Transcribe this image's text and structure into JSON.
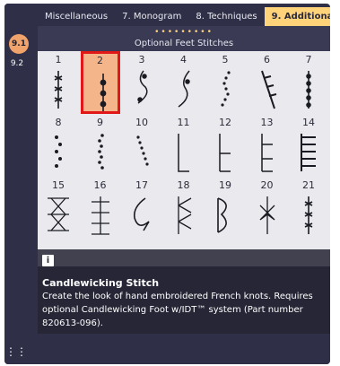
{
  "tabs": [
    {
      "label": "Miscellaneous",
      "active": false
    },
    {
      "label": "7. Monogram",
      "active": false
    },
    {
      "label": "8. Techniques",
      "active": false
    },
    {
      "label": "9. Additional",
      "active": true
    }
  ],
  "sidebar": {
    "active_badge": "9.1",
    "items": [
      {
        "label": "9.2"
      }
    ]
  },
  "header": {
    "pager_dots": "•••••••••",
    "subtitle": "Optional Feet Stitches"
  },
  "stitches": [
    {
      "number": "1",
      "icon": "stitch-icon"
    },
    {
      "number": "2",
      "icon": "stitch-icon",
      "selected": true
    },
    {
      "number": "3",
      "icon": "stitch-icon"
    },
    {
      "number": "4",
      "icon": "stitch-icon"
    },
    {
      "number": "5",
      "icon": "stitch-icon"
    },
    {
      "number": "6",
      "icon": "stitch-icon"
    },
    {
      "number": "7",
      "icon": "stitch-icon"
    },
    {
      "number": "8",
      "icon": "stitch-icon"
    },
    {
      "number": "9",
      "icon": "stitch-icon"
    },
    {
      "number": "10",
      "icon": "stitch-icon"
    },
    {
      "number": "11",
      "icon": "stitch-icon"
    },
    {
      "number": "12",
      "icon": "stitch-icon"
    },
    {
      "number": "13",
      "icon": "stitch-icon"
    },
    {
      "number": "14",
      "icon": "stitch-icon"
    },
    {
      "number": "15",
      "icon": "stitch-icon"
    },
    {
      "number": "16",
      "icon": "stitch-icon"
    },
    {
      "number": "17",
      "icon": "stitch-icon"
    },
    {
      "number": "18",
      "icon": "stitch-icon"
    },
    {
      "number": "19",
      "icon": "stitch-icon"
    },
    {
      "number": "20",
      "icon": "stitch-icon"
    },
    {
      "number": "21",
      "icon": "stitch-icon"
    }
  ],
  "info": {
    "icon_label": "i",
    "title": "Candlewicking Stitch",
    "description": "Create the look of hand embroidered French knots. Requires optional Candlewicking Foot w/IDT™ system (Part number 820613-096)."
  },
  "colors": {
    "accent": "#ffd37a",
    "badge": "#f0a36a",
    "selected_fill": "#f5b58a",
    "selected_border": "#e01818"
  }
}
